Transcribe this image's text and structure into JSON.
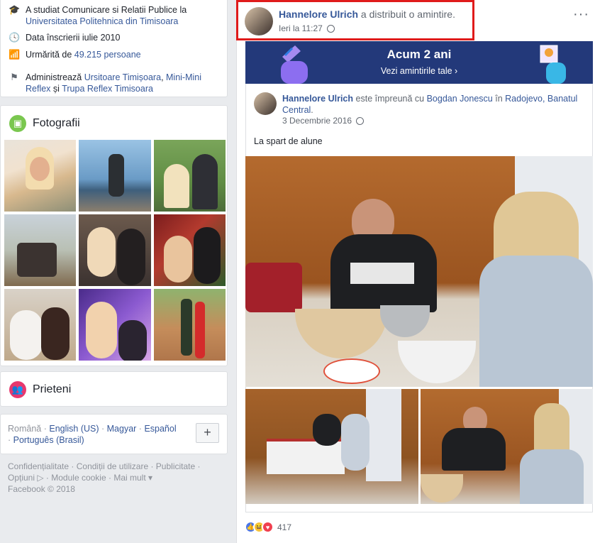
{
  "intro": {
    "studied_prefix": "A studiat Comunicare si Relatii Publice la",
    "studied_school": "Universitatea Politehnica din Timisoara",
    "joined": "Data înscrierii iulie 2010",
    "followed_prefix": "Urmărită de",
    "followed_count": "49.215 persoane",
    "admin_prefix": "Administrează",
    "admin_page1": "Ursitoare Timișoara",
    "admin_page2": "Mini-Mini Reflex",
    "admin_and": "și",
    "admin_page3": "Trupa Reflex Timisoara"
  },
  "photos": {
    "title": "Fotografii"
  },
  "friends": {
    "title": "Prieteni"
  },
  "languages": {
    "items": [
      "Română",
      "English (US)",
      "Magyar",
      "Español",
      "Português (Brasil)"
    ],
    "sep": " · "
  },
  "footer": {
    "links": [
      "Confidențialitate",
      "Condiții de utilizare",
      "Publicitate",
      "Opțiuni ▷",
      "Module cookie",
      "Mai mult ▾"
    ],
    "copyright": "Facebook © 2018"
  },
  "post": {
    "author": "Hannelore Ulrich",
    "action": "a distribuit o amintire.",
    "time": "Ieri la 11:27",
    "memory_title": "Acum 2 ani",
    "memory_link": "Vezi amintirile tale ›",
    "inner_author": "Hannelore Ulrich",
    "inner_with": "este împreună cu",
    "inner_friend": "Bogdan Jonescu",
    "inner_in": "în",
    "inner_place": "Radojevo, Banatul Central",
    "inner_date": "3 Decembrie 2016",
    "caption": "La spart de alune",
    "reaction_count": "417"
  },
  "colors": {
    "link": "#365899",
    "highlight": "#e01b1b",
    "memory_bg": "#23397a"
  }
}
